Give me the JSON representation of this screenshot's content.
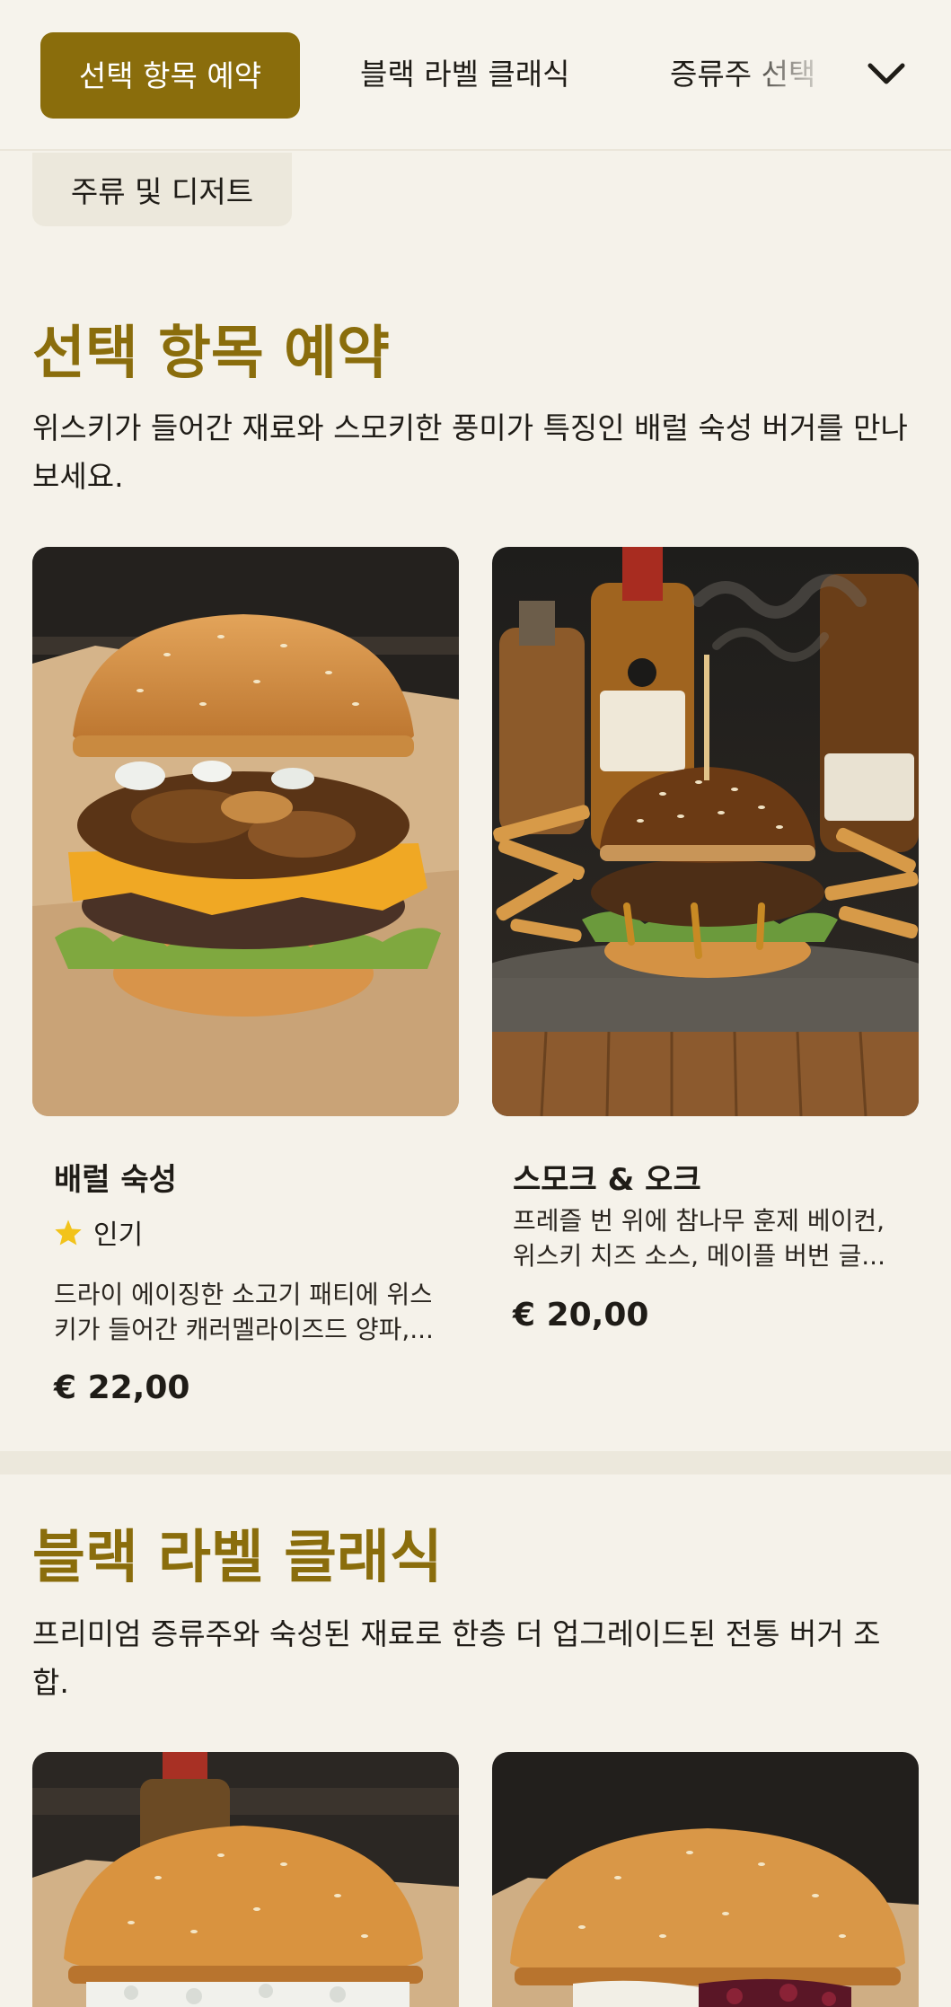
{
  "nav": {
    "tabs": [
      {
        "label": "선택 항목 예약",
        "active": true
      },
      {
        "label": "블랙 라벨 클래식",
        "active": false
      },
      {
        "label": "증류주 선택",
        "active": false
      },
      {
        "label": "주류 및 디저트",
        "active": false
      }
    ],
    "expand_icon": "chevron-down-icon"
  },
  "sections": [
    {
      "title": "선택 항목 예약",
      "description": "위스키가 들어간 재료와 스모키한 풍미가 특징인 배럴 숙성 버거를 만나보세요.",
      "items": [
        {
          "name": "배럴 숙성",
          "badge": "인기",
          "badge_icon": "star-icon",
          "description_lines": [
            "드라이 에이징한 소고기 패티에 위스",
            "키가 들어간 캐러멜라이즈드 양파,..."
          ],
          "price": "€ 22,00"
        },
        {
          "name": "스모크 & 오크",
          "description_lines": [
            "프레즐 번 위에 참나무 훈제 베이컨,",
            "위스키 치즈 소스, 메이플 버번 글..."
          ],
          "price": "€ 20,00"
        }
      ]
    },
    {
      "title": "블랙 라벨 클래식",
      "description": "프리미엄 증류주와 숙성된 재료로 한층 더 업그레이드된 전통 버거 조합."
    }
  ],
  "colors": {
    "accent": "#8a6d0c",
    "background": "#f5f2ea",
    "chip_inactive": "#ece8dc",
    "star": "#f2c31b"
  }
}
